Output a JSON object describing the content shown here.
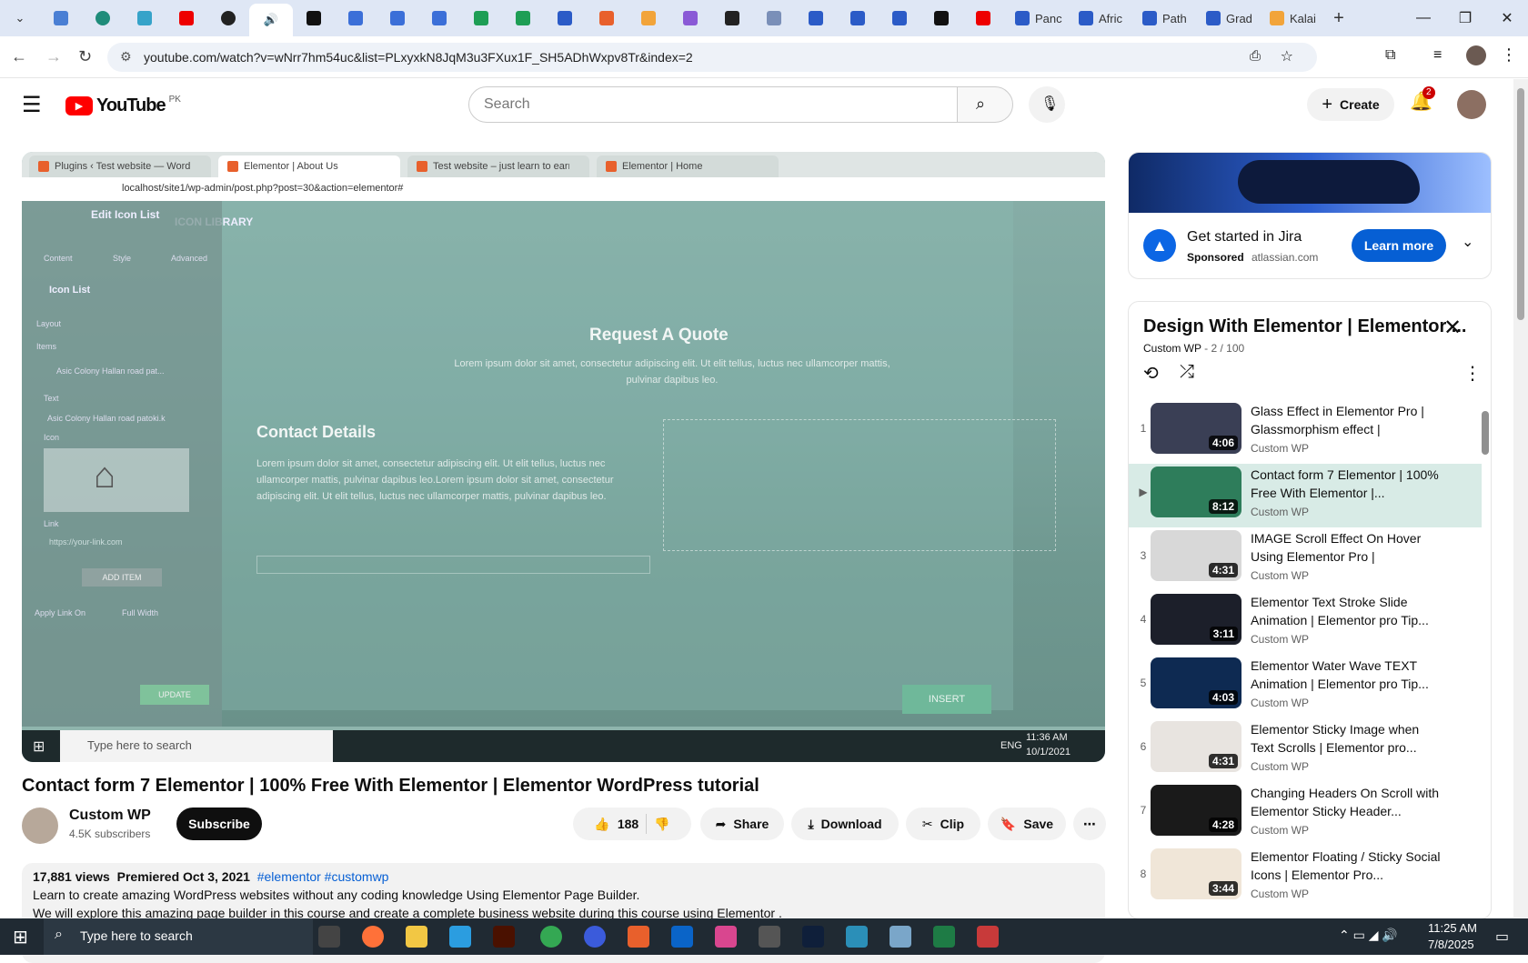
{
  "browser": {
    "url": "youtube.com/watch?v=wNrr7hm54uc&list=PLxyxkN8JqM3u3FXux1F_SH5ADhWxpv8Tr&index=2",
    "tabs": [
      "Panc",
      "Afric",
      "Path",
      "Grad",
      "Kalai"
    ]
  },
  "header": {
    "logo": "YouTube",
    "country": "PK",
    "search_placeholder": "Search",
    "create_label": "Create",
    "notif_count": "2"
  },
  "video": {
    "title": "Contact form 7 Elementor | 100% Free With Elementor | Elementor WordPress tutorial",
    "inner_tabs": [
      "Plugins ‹ Test website — WordPr...",
      "Elementor | About Us",
      "Test website – just learn to earn",
      "Elementor | Home"
    ],
    "inner_url": "localhost/site1/wp-admin/post.php?post=30&action=elementor#",
    "panel_title": "Edit Icon List",
    "library_label": "ICON LIBRARY",
    "panel_items": [
      "Content",
      "Style",
      "Advanced",
      "Icon List",
      "Layout",
      "Items",
      "Text",
      "Icon",
      "Link",
      "ADD ITEM",
      "Apply Link On",
      "Full Width",
      "UPDATE"
    ],
    "item_text": "Asic Colony Hallan road pat...",
    "item_text2": "Asic Colony Hallan road patoki.k",
    "link_placeholder": "https://your-link.com",
    "quote_title": "Request A Quote",
    "quote_body": "Lorem ipsum dolor sit amet, consectetur adipiscing elit. Ut elit tellus, luctus nec ullamcorper mattis, pulvinar dapibus leo.",
    "contact_title": "Contact Details",
    "contact_body": "Lorem ipsum dolor sit amet, consectetur adipiscing elit. Ut elit tellus, luctus nec ullamcorper mattis, pulvinar dapibus leo.Lorem ipsum dolor sit amet, consectetur adipiscing elit. Ut elit tellus, luctus nec ullamcorper mattis, pulvinar dapibus leo.",
    "insert_label": "INSERT",
    "taskbar_search": "Type here to search",
    "taskbar_lang": "ENG",
    "taskbar_time": "11:36 AM",
    "taskbar_date": "10/1/2021"
  },
  "channel": {
    "name": "Custom WP",
    "subs": "4.5K subscribers",
    "subscribe_label": "Subscribe",
    "likes": "188",
    "share_label": "Share",
    "download_label": "Download",
    "clip_label": "Clip",
    "save_label": "Save"
  },
  "description": {
    "views": "17,881 views",
    "premiered": "Premiered Oct 3, 2021",
    "tags": "#elementor #customwp",
    "line1": "Learn to create amazing WordPress websites without any coding knowledge Using Elementor Page Builder.",
    "line2": "We will explore this amazing page builder in this course and create a complete business website during this course using Elementor ."
  },
  "ad": {
    "title": "Get started in Jira",
    "sponsored": "Sponsored",
    "domain": "atlassian.com",
    "button": "Learn more"
  },
  "playlist": {
    "title": "Design With Elementor | Elementor ...",
    "channel": "Custom WP",
    "position": "2 / 100",
    "items": [
      {
        "num": "1",
        "title": "Glass Effect in Elementor Pro | Glassmorphism effect | Elementor...",
        "channel": "Custom WP",
        "dur": "4:06",
        "color": "#3a3f55"
      },
      {
        "num": "▶",
        "title": "Contact form 7 Elementor | 100% Free With Elementor |...",
        "channel": "Custom WP",
        "dur": "8:12",
        "color": "#2e7d5b"
      },
      {
        "num": "3",
        "title": "IMAGE Scroll Effect On Hover Using Elementor Pro | Elementor...",
        "channel": "Custom WP",
        "dur": "4:31",
        "color": "#d8d8d8"
      },
      {
        "num": "4",
        "title": "Elementor Text Stroke Slide Animation | Elementor pro Tip...",
        "channel": "Custom WP",
        "dur": "3:11",
        "color": "#1c1f2a"
      },
      {
        "num": "5",
        "title": "Elementor Water Wave TEXT Animation | Elementor pro Tip...",
        "channel": "Custom WP",
        "dur": "4:03",
        "color": "#0e2a52"
      },
      {
        "num": "6",
        "title": "Elementor Sticky Image when Text Scrolls | Elementor pro...",
        "channel": "Custom WP",
        "dur": "4:31",
        "color": "#e8e4e0"
      },
      {
        "num": "7",
        "title": "Changing Headers On Scroll with Elementor Sticky Header...",
        "channel": "Custom WP",
        "dur": "4:28",
        "color": "#1a1a1a"
      },
      {
        "num": "8",
        "title": "Elementor Floating / Sticky Social Icons | Elementor Pro...",
        "channel": "Custom WP",
        "dur": "3:44",
        "color": "#f0e6d8"
      }
    ]
  },
  "taskbar": {
    "search": "Type here to search",
    "time": "11:25 AM",
    "date": "7/8/2025"
  },
  "colors": {
    "yt_red": "#ff0000",
    "brand_blue": "#065fd4",
    "jira_blue": "#0c66e4"
  }
}
